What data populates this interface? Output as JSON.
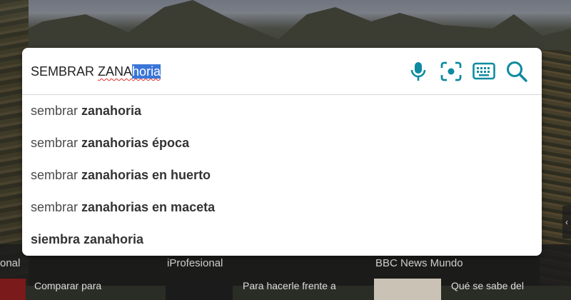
{
  "search": {
    "query_prefix": "SEMBRAR ",
    "query_typed": "ZANA",
    "query_selected": "horia",
    "icons": {
      "voice": "microphone-icon",
      "visual": "camera-focus-icon",
      "keyboard": "keyboard-icon",
      "search": "magnifier-icon"
    },
    "accent_color": "#0e8aa0",
    "selection_color": "#3a76d8"
  },
  "suggestions": [
    {
      "plain": "sembrar ",
      "bold": "zanahoria"
    },
    {
      "plain": "sembrar ",
      "bold": "zanahorias época"
    },
    {
      "plain": "sembrar ",
      "bold": "zanahorias en huerto"
    },
    {
      "plain": "sembrar ",
      "bold": "zanahorias en maceta"
    },
    {
      "plain": "",
      "bold": "siembra zanahoria"
    }
  ],
  "news": {
    "col1": {
      "source": "onal",
      "headline": "Comparar para"
    },
    "col2": {
      "source": "iProfesional",
      "headline": "Para hacerle frente a"
    },
    "col3": {
      "source": "BBC News Mundo",
      "headline": "Qué se sabe del"
    }
  },
  "nav": {
    "right_arrow": "‹"
  }
}
